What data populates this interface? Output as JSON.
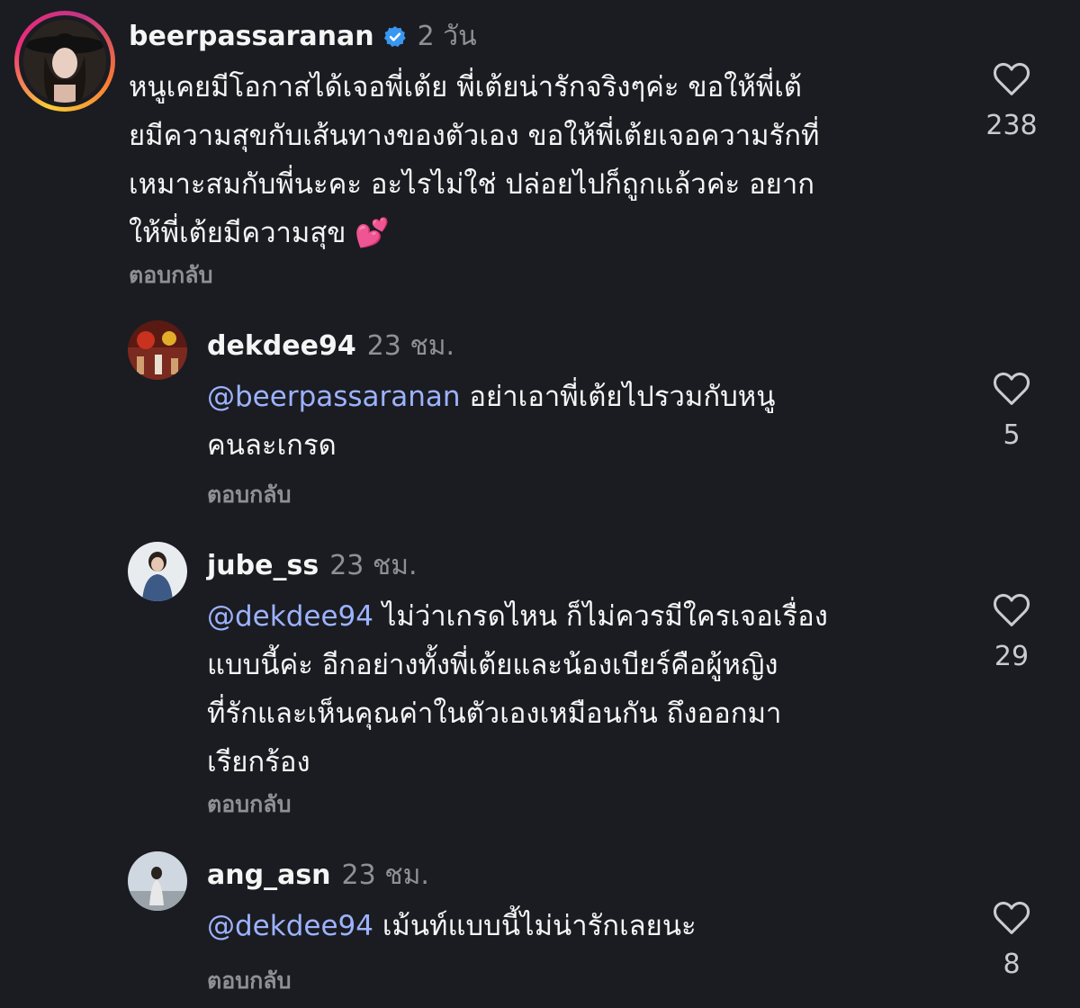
{
  "comments": [
    {
      "username": "beerpassaranan",
      "verified": true,
      "time": "2 วัน",
      "lines": [
        "หนูเคยมีโอกาสได้เจอพี่เต้ย พี่เต้ยน่ารักจริงๆค่ะ ขอให้พี่เต้",
        "ยมีความสุขกับเส้นทางของตัวเอง ขอให้พี่เต้ยเจอความรักที่",
        "เหมาะสมกับพี่นะคะ อะไรไม่ใช่ ปล่อยไปก็ถูกแล้วค่ะ อยาก",
        "ให้พี่เต้ยมีความสุข 💕"
      ],
      "reply_label": "ตอบกลับ",
      "likes": "238",
      "icons": {
        "verified": "verified-badge-icon",
        "like": "heart-icon"
      },
      "colors": {
        "verified": "#3897f0"
      }
    },
    {
      "username": "dekdee94",
      "time": "23 ชม.",
      "mention": "@beerpassaranan",
      "first_line_rest": " อย่าเอาพี่เต้ยไปรวมกับหนู",
      "lines": [
        "คนละเกรด"
      ],
      "reply_label": "ตอบกลับ",
      "likes": "5"
    },
    {
      "username": "jube_ss",
      "time": "23 ชม.",
      "mention": "@dekdee94",
      "first_line_rest": " ไม่ว่าเกรดไหน ก็ไม่ควรมีใครเจอเรื่อง",
      "lines": [
        "แบบนี้ค่ะ อีกอย่างทั้งพี่เต้ยและน้องเบียร์คือผู้หญิง",
        "ที่รักและเห็นคุณค่าในตัวเองเหมือนกัน ถึงออกมา",
        "เรียกร้อง"
      ],
      "reply_label": "ตอบกลับ",
      "likes": "29"
    },
    {
      "username": "ang_asn",
      "time": "23 ชม.",
      "mention": "@dekdee94",
      "first_line_rest": " เม้นท์แบบนี้ไม่น่ารักเลยนะ",
      "lines": [],
      "reply_label": "ตอบกลับ",
      "likes": "8"
    }
  ],
  "colors": {
    "background": "#1a1c21",
    "text": "#f5f5f5",
    "muted": "#8e9097",
    "mention": "#9db2ff"
  }
}
